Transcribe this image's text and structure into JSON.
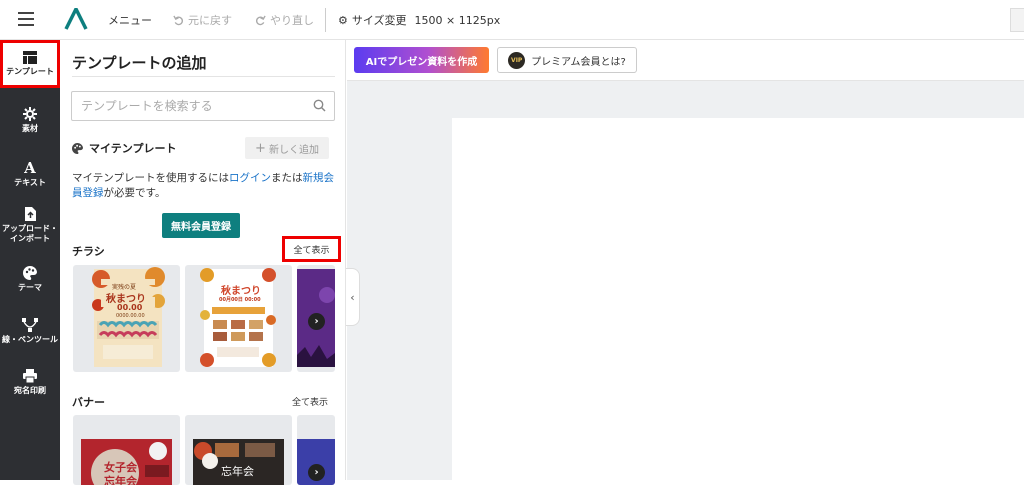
{
  "topbar": {
    "menu": "メニュー",
    "undo": "元に戻す",
    "redo": "やり直し",
    "resize": "サイズ変更",
    "size": "1500 × 1125px"
  },
  "sidebar": {
    "items": [
      {
        "label": "テンプレート"
      },
      {
        "label": "素材"
      },
      {
        "label": "テキスト"
      },
      {
        "label1": "アップロード・",
        "label2": "インポート"
      },
      {
        "label": "テーマ"
      },
      {
        "label": "線・ペンツール"
      },
      {
        "label": "宛名印刷"
      }
    ]
  },
  "panel": {
    "title": "テンプレートの追加",
    "search_placeholder": "テンプレートを検索する",
    "my_templates": "マイテンプレート",
    "add_new": "新しく追加",
    "notice_before": "マイテンプレートを使用するには",
    "login_link": "ログイン",
    "notice_mid": "または",
    "register_link": "新規会員登録",
    "notice_after": "が必要です。",
    "register_button": "無料会員登録",
    "sections": [
      {
        "label": "チラシ",
        "show_all": "全て表示"
      },
      {
        "label": "バナー",
        "show_all": "全て表示"
      }
    ],
    "flyer1": {
      "line1": "実残の夏",
      "line2": "秋まつり",
      "line3": "00.00",
      "line4": "0000.00.00"
    },
    "flyer2": {
      "line1": "秋まつり",
      "line2": "00月00日 00:00"
    },
    "banner1": {
      "line1": "女子会",
      "line2": "忘年会"
    },
    "banner2": {
      "line1": "忘年会"
    }
  },
  "canvas": {
    "ai_button": "AIでプレゼン資料を作成",
    "vip_badge": "VIP",
    "vip_button": "プレミアム会員とは?"
  },
  "colors": {
    "sidebar_bg": "#2d2f33",
    "accent_teal": "#0e7f7f",
    "link_blue": "#1a73c8",
    "highlight_red": "#e00000"
  }
}
